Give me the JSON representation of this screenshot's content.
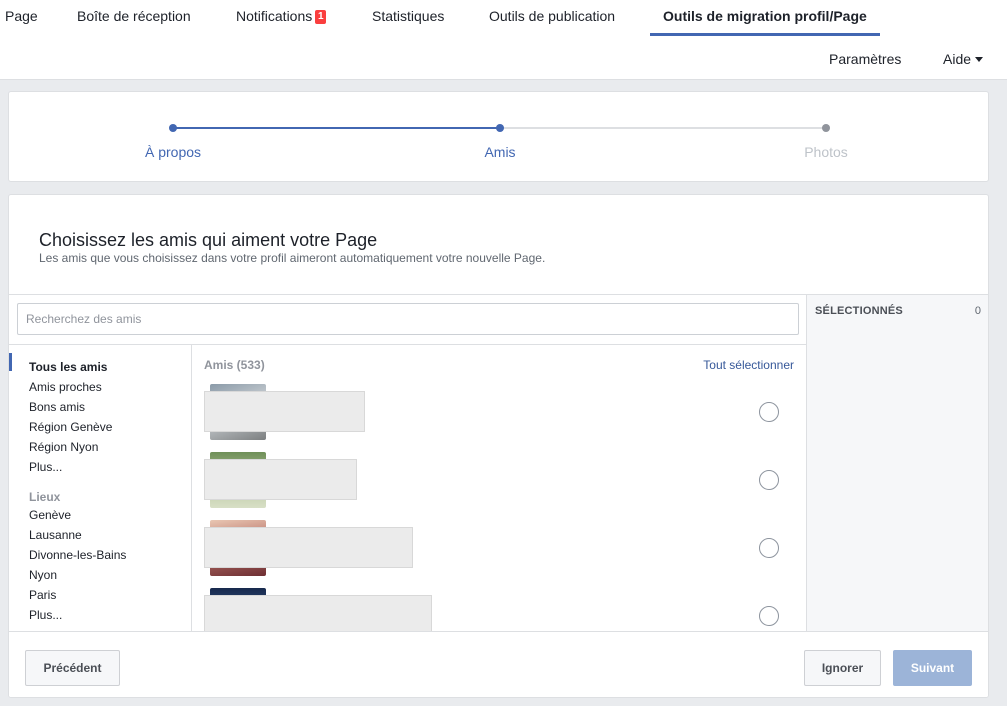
{
  "nav": {
    "tabs": [
      {
        "label": "Page"
      },
      {
        "label": "Boîte de réception"
      },
      {
        "label": "Notifications",
        "badge": "1"
      },
      {
        "label": "Statistiques"
      },
      {
        "label": "Outils de publication"
      },
      {
        "label": "Outils de migration profil/Page",
        "active": true
      }
    ],
    "settings_label": "Paramètres",
    "help_label": "Aide"
  },
  "stepper": {
    "steps": [
      {
        "label": "À propos",
        "state": "done"
      },
      {
        "label": "Amis",
        "state": "current"
      },
      {
        "label": "Photos",
        "state": "upcoming"
      }
    ]
  },
  "main": {
    "title": "Choisissez les amis qui aiment votre Page",
    "subtitle": "Les amis que vous choisissez dans votre profil aimeront automatiquement votre nouvelle Page.",
    "search": {
      "placeholder": "Recherchez des amis",
      "value": ""
    },
    "filters": [
      {
        "label": "Tous les amis",
        "active": true
      },
      {
        "label": "Amis proches"
      },
      {
        "label": "Bons amis"
      },
      {
        "label": "Région Genève"
      },
      {
        "label": "Région Nyon"
      },
      {
        "label": "Plus..."
      }
    ],
    "places_heading": "Lieux",
    "places": [
      {
        "label": "Genève"
      },
      {
        "label": "Lausanne"
      },
      {
        "label": "Divonne-les-Bains"
      },
      {
        "label": "Nyon"
      },
      {
        "label": "Paris"
      },
      {
        "label": "Plus..."
      }
    ],
    "friends_header": "Amis (533)",
    "select_all": "Tout sélectionner",
    "friends": [
      {
        "selected": false
      },
      {
        "selected": false
      },
      {
        "selected": false
      },
      {
        "selected": false
      }
    ],
    "selected_panel": {
      "title": "SÉLECTIONNÉS",
      "count": "0"
    }
  },
  "footer": {
    "previous_label": "Précédent",
    "ignore_label": "Ignorer",
    "next_label": "Suivant"
  },
  "colors": {
    "accent": "#4267b2",
    "link": "#365899",
    "badge": "#fa3e3e",
    "primary_disabled": "#9cb4d8",
    "inactive_step": "#90949c"
  }
}
